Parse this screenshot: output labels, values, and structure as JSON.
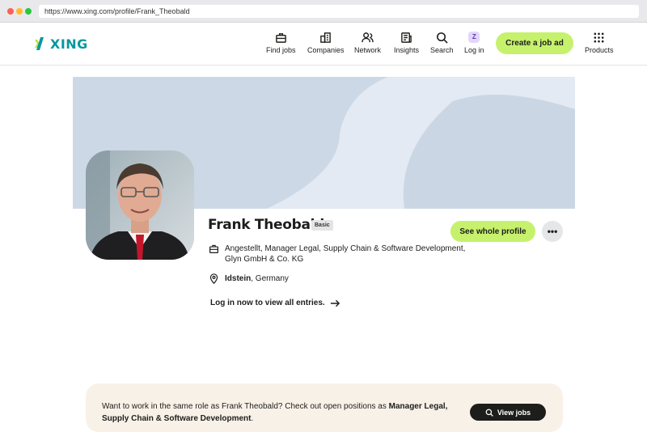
{
  "browser": {
    "url": "https://www.xing.com/profile/Frank_Theobald"
  },
  "header": {
    "logo_text": "XING",
    "brand_color": "#0698a0",
    "accent_color": "#c6f16d",
    "nav": [
      {
        "label": "Find jobs",
        "icon": "briefcase-icon"
      },
      {
        "label": "Companies",
        "icon": "building-icon"
      },
      {
        "label": "Network",
        "icon": "people-icon"
      },
      {
        "label": "Insights",
        "icon": "newspaper-icon"
      },
      {
        "label": "Search",
        "icon": "search-icon"
      },
      {
        "label": "Log in",
        "icon": "login-badge-icon",
        "badge": "Z"
      },
      {
        "label": "Products",
        "icon": "grid-icon"
      }
    ],
    "create_job_label": "Create a job ad"
  },
  "profile": {
    "name": "Frank Theobald",
    "membership": "Basic",
    "see_profile_label": "See whole profile",
    "more_label": "•••",
    "job": "Angestellt, Manager Legal, Supply Chain & Software Development, Glyn GmbH & Co. KG",
    "city": "Idstein",
    "country_suffix": ", Germany",
    "login_prompt": "Log in now to view all entries."
  },
  "banner": {
    "text_prefix": "Want to work in the same role as Frank Theobald? Check out open positions as ",
    "role": "Manager Legal, Supply Chain & Software Development",
    "text_suffix": ".",
    "button_label": "View jobs"
  }
}
